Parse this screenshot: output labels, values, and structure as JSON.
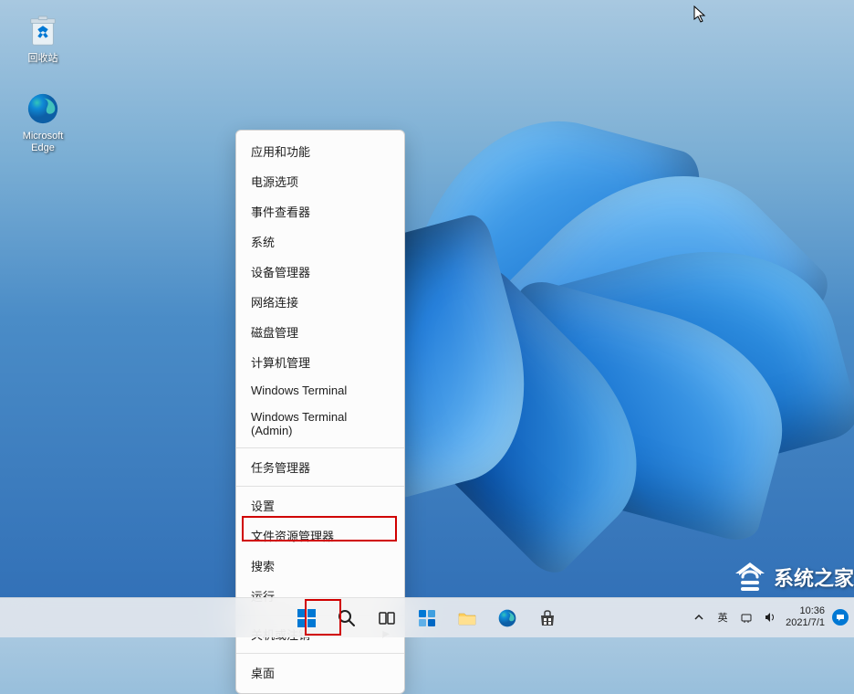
{
  "desktop": {
    "icons": [
      {
        "name": "recycle-bin",
        "label": "回收站"
      },
      {
        "name": "microsoft-edge",
        "label": "Microsoft\nEdge"
      }
    ]
  },
  "context_menu": {
    "items": [
      {
        "label": "应用和功能",
        "id": "apps-features"
      },
      {
        "label": "电源选项",
        "id": "power-options"
      },
      {
        "label": "事件查看器",
        "id": "event-viewer"
      },
      {
        "label": "系统",
        "id": "system"
      },
      {
        "label": "设备管理器",
        "id": "device-manager"
      },
      {
        "label": "网络连接",
        "id": "network-connections"
      },
      {
        "label": "磁盘管理",
        "id": "disk-management"
      },
      {
        "label": "计算机管理",
        "id": "computer-management"
      },
      {
        "label": "Windows Terminal",
        "id": "windows-terminal"
      },
      {
        "label": "Windows Terminal (Admin)",
        "id": "windows-terminal-admin"
      },
      {
        "label": "任务管理器",
        "id": "task-manager"
      },
      {
        "label": "设置",
        "id": "settings"
      },
      {
        "label": "文件资源管理器",
        "id": "file-explorer"
      },
      {
        "label": "搜索",
        "id": "search"
      },
      {
        "label": "运行",
        "id": "run",
        "highlighted": true
      },
      {
        "label": "关机或注销",
        "id": "shutdown-signout",
        "submenu": true
      },
      {
        "label": "桌面",
        "id": "desktop"
      }
    ],
    "dividers_after": [
      9,
      10,
      14,
      15
    ]
  },
  "taskbar": {
    "items": [
      {
        "name": "start-button",
        "highlighted": true
      },
      {
        "name": "search-button"
      },
      {
        "name": "task-view-button"
      },
      {
        "name": "widgets-button"
      },
      {
        "name": "file-explorer-button"
      },
      {
        "name": "edge-button"
      },
      {
        "name": "store-button"
      }
    ]
  },
  "system_tray": {
    "chevron": "^",
    "ime": "英",
    "time": "10:36",
    "date": "2021/7/1"
  },
  "watermark": {
    "text": "系统之家"
  }
}
